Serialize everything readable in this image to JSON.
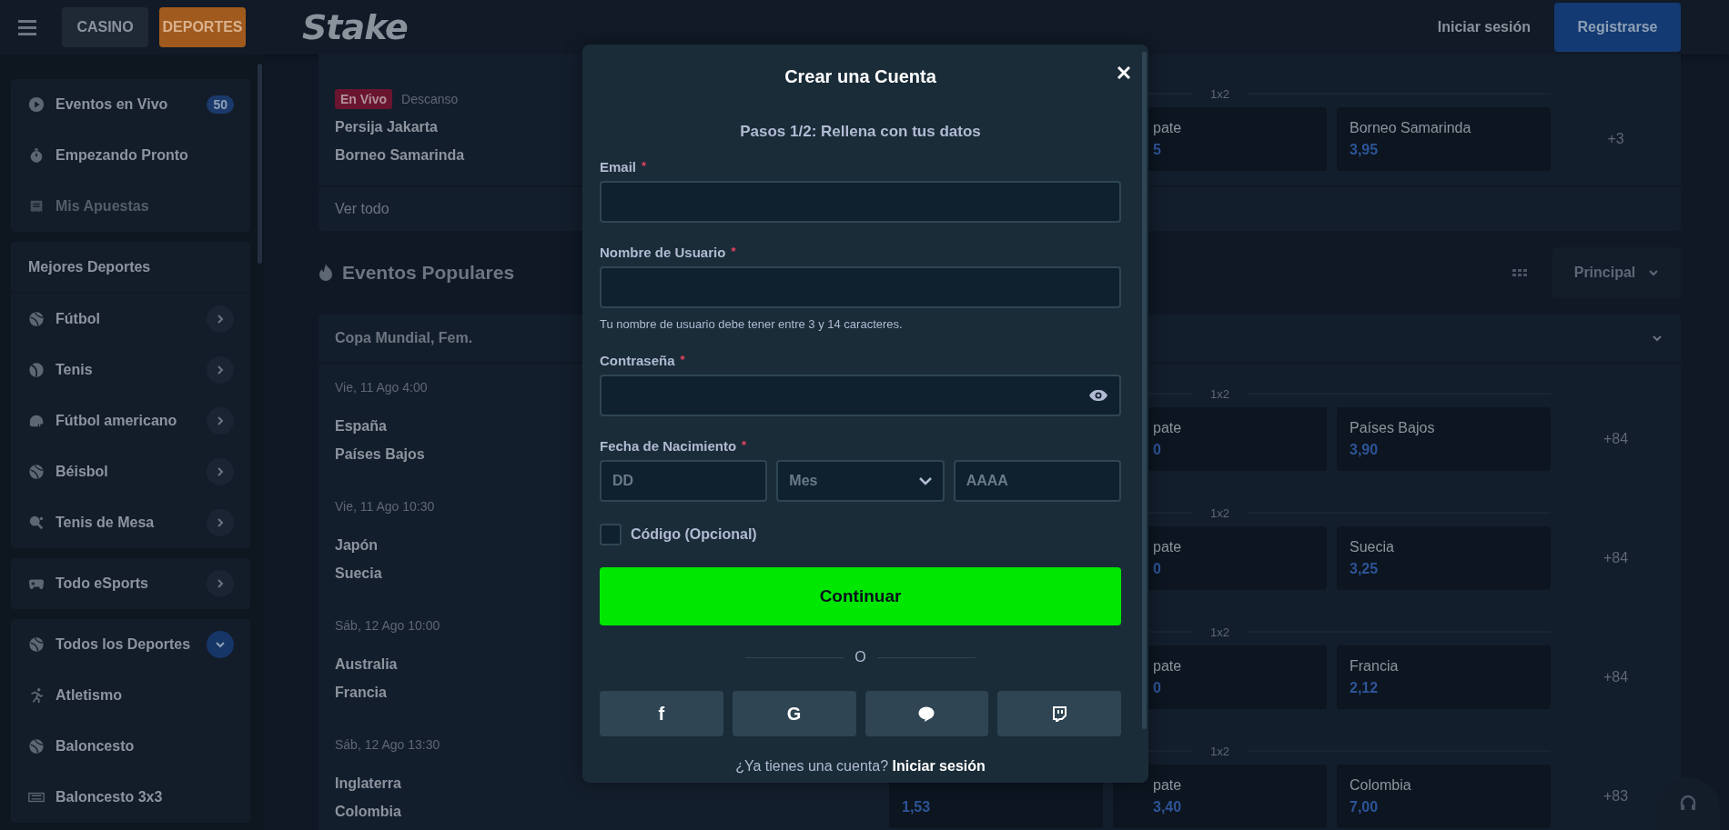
{
  "topbar": {
    "tabs": [
      {
        "label": "CASINO",
        "selected": false
      },
      {
        "label": "DEPORTES",
        "selected": true
      }
    ],
    "logo": "Stake",
    "login": "Iniciar sesión",
    "register": "Registrarse"
  },
  "sidebar": {
    "groups": [
      {
        "items": [
          {
            "kind": "play",
            "label": "Eventos en Vivo",
            "badge": "50",
            "disabled": false
          },
          {
            "kind": "stopwatch",
            "label": "Empezando Pronto",
            "disabled": false
          },
          {
            "kind": "receipt",
            "label": "Mis Apuestas",
            "disabled": true
          }
        ]
      },
      {
        "heading": "Mejores Deportes",
        "items": [
          {
            "kind": "ball",
            "label": "Fútbol",
            "expanded": false
          },
          {
            "kind": "tennis",
            "label": "Tenis",
            "expanded": false
          },
          {
            "kind": "helmet",
            "label": "Fútbol americano",
            "expanded": false
          },
          {
            "kind": "ball",
            "label": "Béisbol",
            "expanded": false
          },
          {
            "kind": "paddle",
            "label": "Tenis de Mesa",
            "expanded": false
          }
        ]
      },
      {
        "items": [
          {
            "kind": "gamepad",
            "label": "Todo eSports",
            "expanded": false
          }
        ]
      },
      {
        "items": [
          {
            "kind": "ball",
            "label": "Todos los Deportes",
            "expanded": true,
            "children": [
              {
                "kind": "runner",
                "label": "Atletismo"
              },
              {
                "kind": "ball",
                "label": "Baloncesto"
              },
              {
                "kind": "striped",
                "label": "Baloncesto 3x3"
              }
            ]
          }
        ]
      }
    ]
  },
  "live": {
    "badge": "En Vivo",
    "status": "Descanso",
    "teams": [
      "Persija Jakarta",
      "Borneo Samarinda"
    ],
    "market": "1x2",
    "draw": {
      "label": "pate",
      "odds": "5"
    },
    "away": {
      "label": "Borneo Samarinda",
      "odds": "3,95"
    },
    "more": "+3",
    "view_all": "Ver todo"
  },
  "popular": {
    "title": "Eventos Populares",
    "market_select": "Principal",
    "league": "Copa Mundial, Fem.",
    "matches": [
      {
        "date": "Vie, 11 Ago 4:00",
        "teams": [
          "España",
          "Países Bajos"
        ],
        "market": "1x2",
        "draw": {
          "label": "pate",
          "odds": "0"
        },
        "away": {
          "label": "Países Bajos",
          "odds": "3,90"
        },
        "more": "+84"
      },
      {
        "date": "Vie, 11 Ago 10:30",
        "teams": [
          "Japón",
          "Suecia"
        ],
        "market": "1x2",
        "draw": {
          "label": "pate",
          "odds": "0"
        },
        "away": {
          "label": "Suecia",
          "odds": "3,25"
        },
        "more": "+84"
      },
      {
        "date": "Sáb, 12 Ago 10:00",
        "teams": [
          "Australia",
          "Francia"
        ],
        "market": "1x2",
        "draw": {
          "label": "pate",
          "odds": "0"
        },
        "away": {
          "label": "Francia",
          "odds": "2,12"
        },
        "more": "+84"
      },
      {
        "date": "Sáb, 12 Ago 13:30",
        "teams": [
          "Inglaterra",
          "Colombia"
        ],
        "market": "1x2",
        "home": {
          "odds": "1,53"
        },
        "draw": {
          "label": "pate",
          "odds": "3,40"
        },
        "away": {
          "label": "Colombia",
          "odds": "7,00"
        },
        "more": "+83"
      }
    ]
  },
  "modal": {
    "title": "Crear una Cuenta",
    "subtitle": "Pasos 1/2: Rellena con tus datos",
    "fields": [
      {
        "kind": "text",
        "label": "Email",
        "required_mark": "*"
      },
      {
        "kind": "text",
        "label": "Nombre de Usuario",
        "required_mark": "*",
        "hint": "Tu nombre de usuario debe tener entre 3 y 14 caracteres."
      },
      {
        "kind": "password",
        "label": "Contraseña",
        "required_mark": "*"
      },
      {
        "kind": "date",
        "label": "Fecha de Nacimiento",
        "required_mark": "*",
        "parts": [
          {
            "kind": "input",
            "placeholder": "DD"
          },
          {
            "kind": "select",
            "placeholder": "Mes"
          },
          {
            "kind": "input",
            "placeholder": "AAAA"
          }
        ]
      }
    ],
    "code": {
      "label": "Código (Opcional)",
      "checked": false
    },
    "submit": "Continuar",
    "divider": "O",
    "socials": [
      {
        "kind": "glyph",
        "glyph": "f"
      },
      {
        "kind": "glyph",
        "glyph": "G"
      },
      {
        "kind": "bubble"
      },
      {
        "kind": "tv"
      }
    ],
    "footer": {
      "text": "¿Ya tienes una cuenta?",
      "link": "Iniciar sesión"
    }
  }
}
